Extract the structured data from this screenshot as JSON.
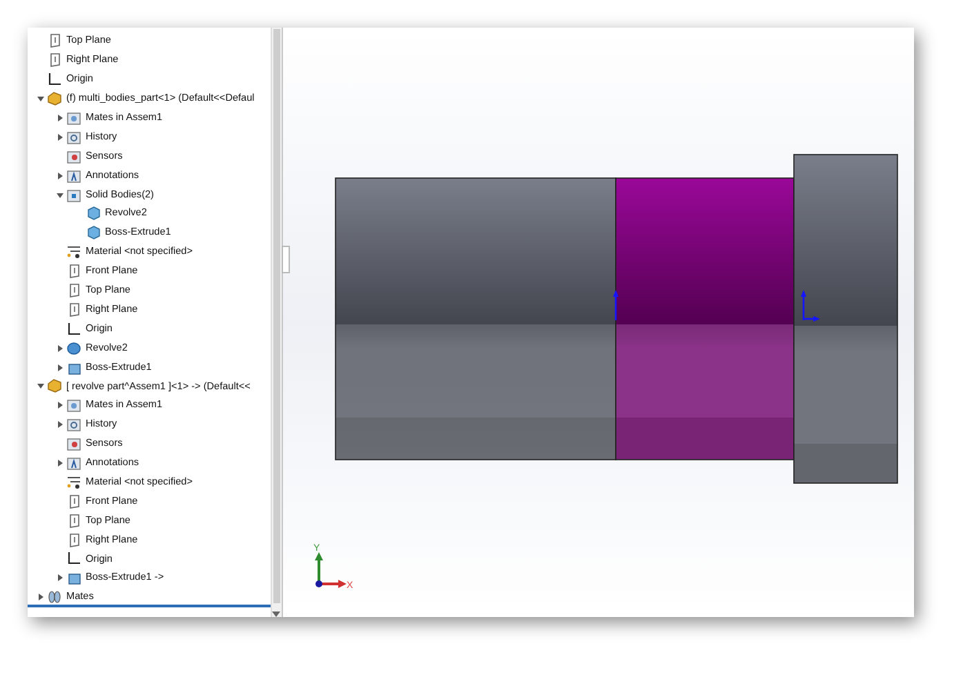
{
  "tree": [
    {
      "label": "Top Plane",
      "kind": "plane"
    },
    {
      "label": "Right Plane",
      "kind": "plane"
    },
    {
      "label": "Origin",
      "kind": "origin"
    },
    {
      "label": "(f) multi_bodies_part<1> (Default<<Defaul",
      "kind": "part",
      "expanded": true,
      "children": [
        {
          "label": "Mates in Assem1",
          "kind": "mates-folder",
          "expanded": false
        },
        {
          "label": "History",
          "kind": "history",
          "expanded": false
        },
        {
          "label": "Sensors",
          "kind": "sensors"
        },
        {
          "label": "Annotations",
          "kind": "annotations",
          "expanded": false
        },
        {
          "label": "Solid Bodies(2)",
          "kind": "bodies",
          "expanded": true,
          "children": [
            {
              "label": "Revolve2",
              "kind": "body"
            },
            {
              "label": "Boss-Extrude1",
              "kind": "body"
            }
          ]
        },
        {
          "label": "Material <not specified>",
          "kind": "material"
        },
        {
          "label": "Front Plane",
          "kind": "plane"
        },
        {
          "label": "Top Plane",
          "kind": "plane"
        },
        {
          "label": "Right Plane",
          "kind": "plane"
        },
        {
          "label": "Origin",
          "kind": "origin"
        },
        {
          "label": "Revolve2",
          "kind": "revolve",
          "expanded": false
        },
        {
          "label": "Boss-Extrude1",
          "kind": "extrude",
          "expanded": false
        }
      ]
    },
    {
      "label": "[ revolve part^Assem1 ]<1> -> (Default<<",
      "kind": "part",
      "expanded": true,
      "children": [
        {
          "label": "Mates in Assem1",
          "kind": "mates-folder",
          "expanded": false
        },
        {
          "label": "History",
          "kind": "history",
          "expanded": false
        },
        {
          "label": "Sensors",
          "kind": "sensors"
        },
        {
          "label": "Annotations",
          "kind": "annotations",
          "expanded": false
        },
        {
          "label": "Material <not specified>",
          "kind": "material"
        },
        {
          "label": "Front Plane",
          "kind": "plane"
        },
        {
          "label": "Top Plane",
          "kind": "plane"
        },
        {
          "label": "Right Plane",
          "kind": "plane"
        },
        {
          "label": "Origin",
          "kind": "origin"
        },
        {
          "label": "Boss-Extrude1 ->",
          "kind": "extrude",
          "expanded": false
        }
      ]
    },
    {
      "label": "Mates",
      "kind": "mates",
      "expanded": false
    }
  ],
  "triad": {
    "x_label": "X",
    "y_label": "Y"
  }
}
